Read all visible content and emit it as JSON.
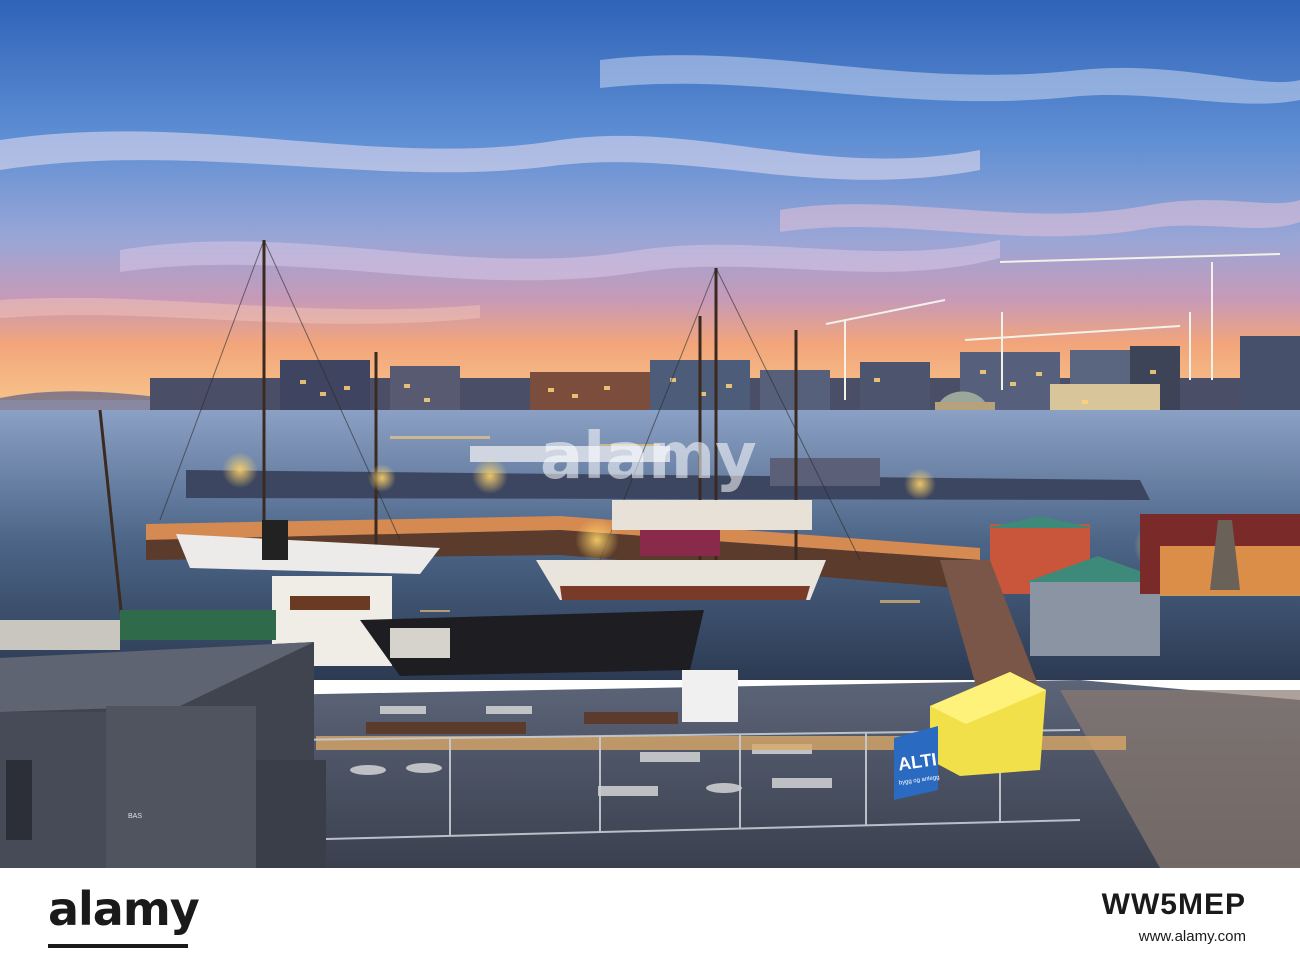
{
  "photo": {
    "scene": "Harbour at dusk with moored wooden sailing ships, illuminated waterfront buildings and construction cranes",
    "signage": {
      "fence_banner_brand": "ALTI",
      "fence_banner_tagline": "bygg og anlegg",
      "hut_sign": "BAS"
    }
  },
  "watermark": {
    "text": "alamy"
  },
  "footer": {
    "brand": "alamy",
    "image_id": "WW5MEP",
    "site": "www.alamy.com"
  }
}
